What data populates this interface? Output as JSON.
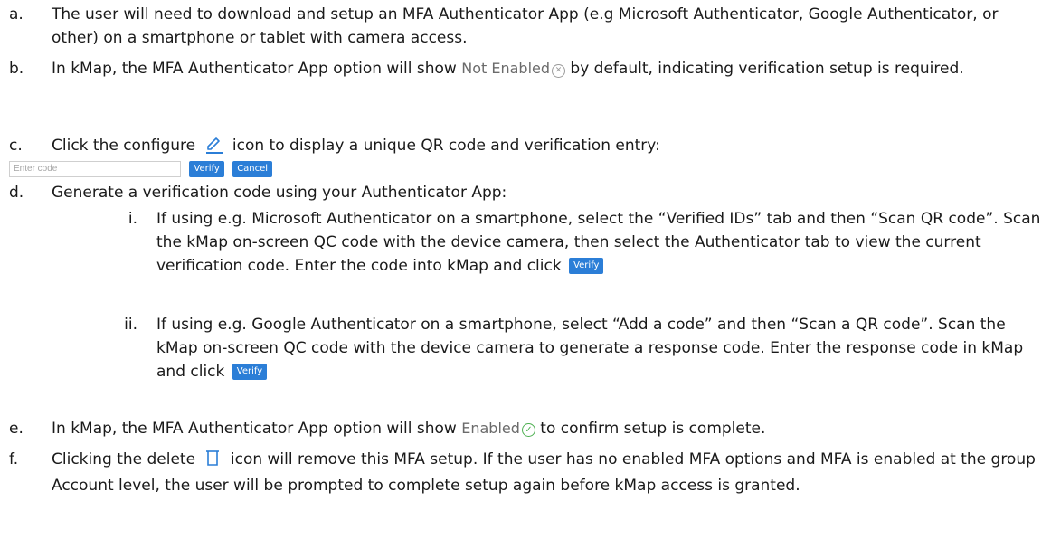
{
  "items": {
    "a": {
      "marker": "a.",
      "text": "The user will need to download and setup an MFA Authenticator App (e.g Microsoft Authenticator, Google Authenticator, or other) on a smartphone or tablet with camera access."
    },
    "b": {
      "marker": "b.",
      "text_before": "In kMap, the MFA Authenticator App option will show",
      "status": "Not Enabled",
      "text_after": "by default, indicating verification setup is required."
    },
    "c": {
      "marker": "c.",
      "text_before": "Click the configure",
      "text_after": "icon to display a unique QR code and verification entry:"
    },
    "d": {
      "marker": "d.",
      "text": "Generate a verification code using your Authenticator App:",
      "sub_i": {
        "marker": "i.",
        "text": "If using e.g. Microsoft Authenticator on a smartphone, select the “Verified IDs” tab and then “Scan QR code”. Scan the kMap on-screen QC code with the device camera, then select the Authenticator tab to view the current verification code. Enter the code into kMap and click"
      },
      "sub_ii": {
        "marker": "ii.",
        "text": "If using e.g. Google Authenticator on a smartphone, select “Add a code” and then “Scan a QR code”. Scan the kMap on-screen QC code with the device camera to generate a response code. Enter the response code in kMap and click"
      }
    },
    "e": {
      "marker": "e.",
      "text_before": "In kMap, the MFA Authenticator App option will show",
      "status": "Enabled",
      "text_after": "to confirm setup is complete."
    },
    "f": {
      "marker": "f.",
      "text_before": "Clicking the delete",
      "text_after": "icon will remove this MFA setup. If the user has no enabled MFA options and MFA is enabled at the group Account level, the user will be prompted to complete setup again before kMap access is granted."
    }
  },
  "code_entry": {
    "placeholder": "Enter code",
    "verify_label": "Verify",
    "cancel_label": "Cancel"
  },
  "icons": {
    "configure": "pencil-icon",
    "delete": "trash-icon",
    "not_enabled": "circle-x-icon",
    "enabled": "circle-check-icon"
  },
  "colors": {
    "button": "#2b7ed7",
    "pencil": "#2b7ed7",
    "enabled": "#4caf50",
    "not_enabled": "#9a9a9a"
  }
}
